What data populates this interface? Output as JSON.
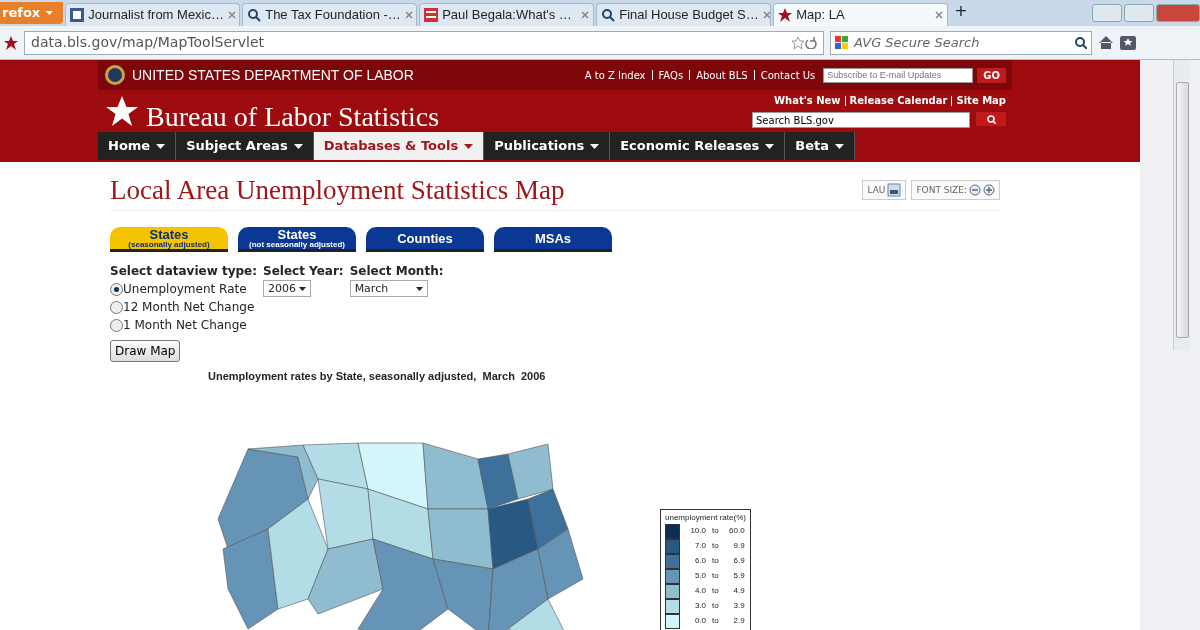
{
  "browser": {
    "app_button": "refox",
    "tabs": [
      {
        "label": "Journalist from Mexic…",
        "selected": false,
        "kind": "g"
      },
      {
        "label": "The Tax Foundation -…",
        "selected": false,
        "kind": "search"
      },
      {
        "label": "Paul Begala:What's …",
        "selected": false,
        "kind": "news"
      },
      {
        "label": "Final House Budget S…",
        "selected": false,
        "kind": "search"
      },
      {
        "label": "Map: LA",
        "selected": true,
        "kind": "star"
      }
    ],
    "new_tab": "+",
    "address": "data.bls.gov/map/MapToolServlet",
    "search_placeholder": "AVG Secure Search"
  },
  "header": {
    "agency": "UNITED STATES DEPARTMENT OF LABOR",
    "top_links": [
      "A to Z Index",
      "FAQs",
      "About BLS",
      "Contact Us"
    ],
    "subscribe_placeholder": "Subscribe to E-mail Updates",
    "go": "GO",
    "secondary_links": [
      "What's New",
      "Release Calendar",
      "Site Map"
    ],
    "site_title": "Bureau of Labor Statistics",
    "search_value": "Search BLS.gov",
    "nav": [
      {
        "label": "Home",
        "selected": false
      },
      {
        "label": "Subject Areas",
        "selected": false
      },
      {
        "label": "Databases & Tools",
        "selected": true
      },
      {
        "label": "Publications",
        "selected": false
      },
      {
        "label": "Economic Releases",
        "selected": false
      },
      {
        "label": "Beta",
        "selected": false
      }
    ]
  },
  "page": {
    "title": "Local Area Unemployment Statistics Map",
    "lau": "LAU",
    "font_size": "FONT SIZE:",
    "data_tabs": [
      {
        "label": "States",
        "sub": "(seasonally adjusted)",
        "selected": true
      },
      {
        "label": "States",
        "sub": "(not seasonally adjusted)",
        "selected": false
      },
      {
        "label": "Counties",
        "selected": false
      },
      {
        "label": "MSAs",
        "selected": false
      }
    ],
    "dataview_label": "Select dataview type:",
    "dataview_options": [
      {
        "label": "Unemployment Rate",
        "selected": true
      },
      {
        "label": "12 Month Net Change",
        "selected": false
      },
      {
        "label": "1 Month Net Change",
        "selected": false
      }
    ],
    "year_label": "Select Year:",
    "year": "2006",
    "month_label": "Select Month:",
    "month": "March",
    "draw_button": "Draw Map",
    "map_title": "Unemployment rates by State, seasonally adjusted,  March  2006",
    "legend": {
      "title": "unemployment rate(%)",
      "items": [
        {
          "low": "10.0",
          "to": "to",
          "high": "60.0",
          "color": "#0b2d57"
        },
        {
          "low": "7.0",
          "to": "to",
          "high": "9.9",
          "color": "#285884"
        },
        {
          "low": "6.0",
          "to": "to",
          "high": "6.9",
          "color": "#3e709c"
        },
        {
          "low": "5.0",
          "to": "to",
          "high": "5.9",
          "color": "#6594b6"
        },
        {
          "low": "4.0",
          "to": "to",
          "high": "4.9",
          "color": "#8fbccf"
        },
        {
          "low": "3.0",
          "to": "to",
          "high": "3.9",
          "color": "#b2dde6"
        },
        {
          "low": "0.0",
          "to": "to",
          "high": "2.9",
          "color": "#d3f6fa"
        }
      ]
    }
  }
}
